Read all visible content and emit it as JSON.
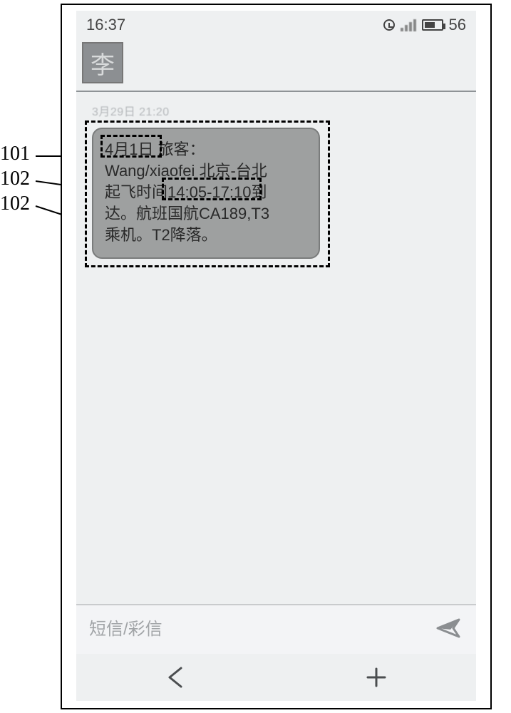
{
  "callouts": {
    "c101": "101",
    "c102a": "102",
    "c102b": "102"
  },
  "status": {
    "time": "16:37",
    "battery_pct": "56"
  },
  "header": {
    "avatar_char": "李"
  },
  "conversation": {
    "timestamp": "3月29日 21:20",
    "bubble": {
      "line1_date": "4月1日",
      "line1_rest": " 旅客：",
      "line2": "Wang/xiaofei  北京-台北",
      "line3_pre": "起飞时间",
      "line3_time": "14:05-17:10",
      "line3_post": "到",
      "line4": "达。航班国航CA189,T3",
      "line5": "乘机。T2降落。"
    }
  },
  "compose": {
    "placeholder": "短信/彩信"
  },
  "icons": {
    "alarm": "alarm-icon",
    "signal": "signal-icon",
    "battery": "battery-icon",
    "send": "send-icon",
    "back": "back-icon",
    "plus": "plus-icon"
  }
}
